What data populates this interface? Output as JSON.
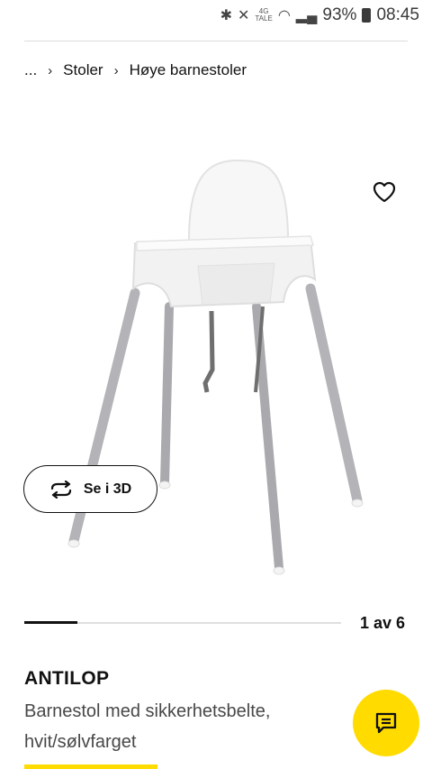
{
  "status_bar": {
    "network_type": "4G",
    "network_sub": "TALE",
    "battery": "93%",
    "time": "08:45"
  },
  "breadcrumb": {
    "ellipsis": "...",
    "items": [
      "Stoler",
      "Høye barnestoler"
    ]
  },
  "gallery": {
    "view3d_label": "Se i 3D",
    "current": 1,
    "total": 6,
    "counter": "1 av 6",
    "progress_fraction": 0.1667
  },
  "product": {
    "name": "ANTILOP",
    "description": "Barnestol med sikkerhetsbelte, hvit/sølvfarget"
  },
  "icons": {
    "favorite": "heart-icon",
    "view3d": "rotate-icon",
    "chat": "chat-icon"
  },
  "colors": {
    "accent_yellow": "#ffdb00",
    "text": "#111111"
  }
}
